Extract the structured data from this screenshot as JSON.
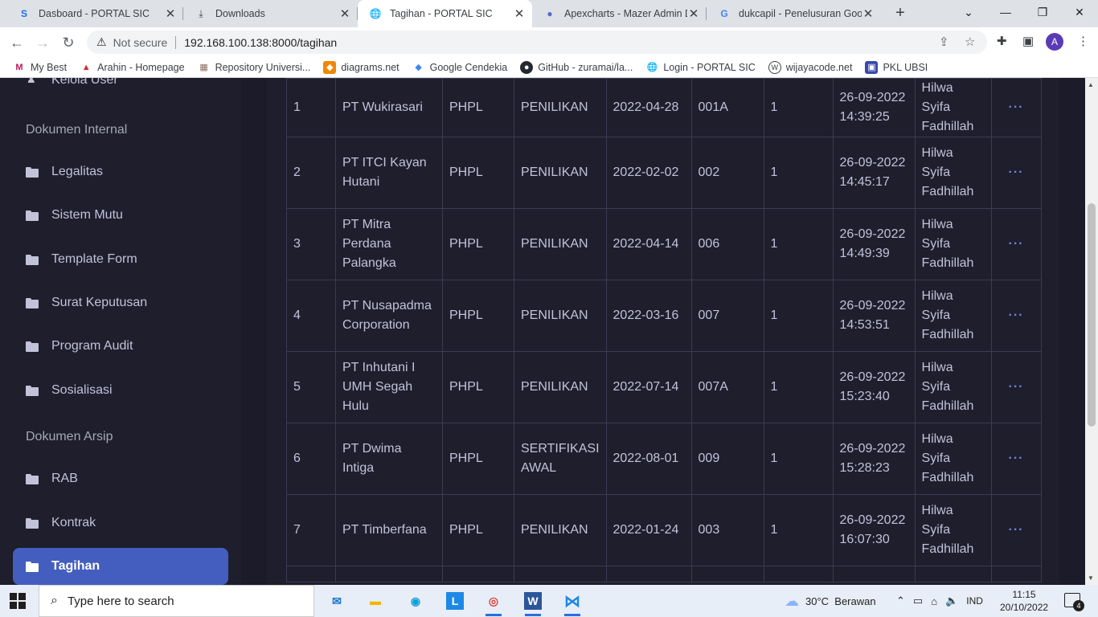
{
  "browser": {
    "tabs": [
      {
        "title": "Dasboard - PORTAL SIC",
        "icon": "sic-logo-icon"
      },
      {
        "title": "Downloads",
        "icon": "download-icon"
      },
      {
        "title": "Tagihan - PORTAL SIC",
        "icon": "globe-icon",
        "active": true
      },
      {
        "title": "Apexcharts - Mazer Admin D",
        "icon": "mazer-icon"
      },
      {
        "title": "dukcapil - Penelusuran Goog",
        "icon": "google-icon"
      }
    ],
    "security_label": "Not secure",
    "url": "192.168.100.138:8000/tagihan",
    "profile_initial": "A",
    "bookmarks": [
      {
        "label": "My Best",
        "icon": "m-logo-icon",
        "color": "#c2185b"
      },
      {
        "label": "Arahin - Homepage",
        "icon": "arrow-logo-icon",
        "color": "#d32f2f"
      },
      {
        "label": "Repository Universi...",
        "icon": "building-icon",
        "color": "#8d6e63"
      },
      {
        "label": "diagrams.net",
        "icon": "diagrams-icon",
        "color": "#f08705"
      },
      {
        "label": "Google Cendekia",
        "icon": "scholar-icon",
        "color": "#4285f4"
      },
      {
        "label": "GitHub - zuramai/la...",
        "icon": "github-icon",
        "color": "#24292f"
      },
      {
        "label": "Login - PORTAL SIC",
        "icon": "globe-icon",
        "color": "#3c4043"
      },
      {
        "label": "wijayacode.net",
        "icon": "wc-logo-icon",
        "color": "#3c4043"
      },
      {
        "label": "PKL UBSI",
        "icon": "pkl-logo-icon",
        "color": "#3949ab"
      }
    ]
  },
  "sidebar": {
    "partial_top_item": "Kelola User",
    "sections": [
      {
        "title": "Dokumen Internal",
        "items": [
          "Legalitas",
          "Sistem Mutu",
          "Template Form",
          "Surat Keputusan",
          "Program Audit",
          "Sosialisasi"
        ]
      },
      {
        "title": "Dokumen Arsip",
        "items": [
          "RAB",
          "Kontrak",
          "Tagihan"
        ]
      }
    ],
    "active_item": "Tagihan"
  },
  "table": {
    "rows": [
      {
        "no": "1",
        "company": "PT Wukirasari",
        "scheme": "PHPL",
        "type": "PENILIKAN",
        "date": "2022-04-28",
        "code": "001A",
        "qty": "1",
        "created": "26-09-2022 14:39:25",
        "user": "Hilwa Syifa Fadhillah"
      },
      {
        "no": "2",
        "company": "PT ITCI Kayan Hutani",
        "scheme": "PHPL",
        "type": "PENILIKAN",
        "date": "2022-02-02",
        "code": "002",
        "qty": "1",
        "created": "26-09-2022 14:45:17",
        "user": "Hilwa Syifa Fadhillah"
      },
      {
        "no": "3",
        "company": "PT Mitra Perdana Palangka",
        "scheme": "PHPL",
        "type": "PENILIKAN",
        "date": "2022-04-14",
        "code": "006",
        "qty": "1",
        "created": "26-09-2022 14:49:39",
        "user": "Hilwa Syifa Fadhillah"
      },
      {
        "no": "4",
        "company": "PT Nusapadma Corporation",
        "scheme": "PHPL",
        "type": "PENILIKAN",
        "date": "2022-03-16",
        "code": "007",
        "qty": "1",
        "created": "26-09-2022 14:53:51",
        "user": "Hilwa Syifa Fadhillah"
      },
      {
        "no": "5",
        "company": "PT Inhutani I UMH Segah Hulu",
        "scheme": "PHPL",
        "type": "PENILIKAN",
        "date": "2022-07-14",
        "code": "007A",
        "qty": "1",
        "created": "26-09-2022 15:23:40",
        "user": "Hilwa Syifa Fadhillah"
      },
      {
        "no": "6",
        "company": "PT Dwima Intiga",
        "scheme": "PHPL",
        "type": "SERTIFIKASI AWAL",
        "date": "2022-08-01",
        "code": "009",
        "qty": "1",
        "created": "26-09-2022 15:28:23",
        "user": "Hilwa Syifa Fadhillah"
      },
      {
        "no": "7",
        "company": "PT Timberfana",
        "scheme": "PHPL",
        "type": "PENILIKAN",
        "date": "2022-01-24",
        "code": "003",
        "qty": "1",
        "created": "26-09-2022 16:07:30",
        "user": "Hilwa Syifa Fadhillah"
      }
    ],
    "action_label": "···"
  },
  "taskbar": {
    "search_placeholder": "Type here to search",
    "weather": "30°C  Berawan",
    "language": "IND",
    "time": "11:15",
    "date": "20/10/2022",
    "notification_count": "4"
  },
  "colors": {
    "accent": "#435ebe",
    "page_bg": "#1b1b29",
    "sidebar_bg": "#1e1e2d",
    "action_dots": "#6d86dd"
  }
}
